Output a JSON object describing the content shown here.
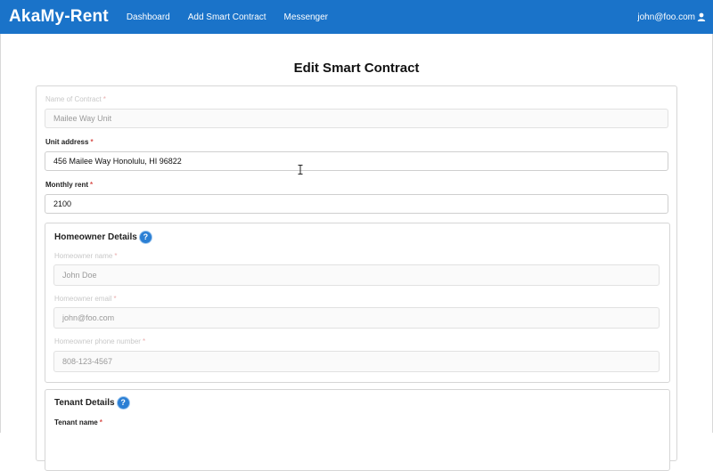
{
  "navbar": {
    "brand": "AkaMy-Rent",
    "links": [
      "Dashboard",
      "Add Smart Contract",
      "Messenger"
    ],
    "user": "john@foo.com",
    "bg_color": "#1a73c9"
  },
  "page": {
    "title": "Edit Smart Contract"
  },
  "form": {
    "contract_name": {
      "label": "Name of Contract",
      "value": "Mailee Way Unit",
      "disabled": true
    },
    "unit_address": {
      "label": "Unit address",
      "value": "456 Mailee Way Honolulu, HI 96822"
    },
    "monthly_rent": {
      "label": "Monthly rent",
      "value": "2100"
    },
    "required_mark": "*"
  },
  "homeowner": {
    "title": "Homeowner Details",
    "help_icon": "question-circle-icon",
    "name": {
      "label": "Homeowner name",
      "value": "John Doe"
    },
    "email": {
      "label": "Homeowner email",
      "value": "john@foo.com"
    },
    "phone": {
      "label": "Homeowner phone number",
      "value": "808-123-4567"
    }
  },
  "tenant": {
    "title": "Tenant Details",
    "help_icon": "question-circle-icon",
    "name": {
      "label": "Tenant name"
    }
  },
  "help_glyph": "?"
}
